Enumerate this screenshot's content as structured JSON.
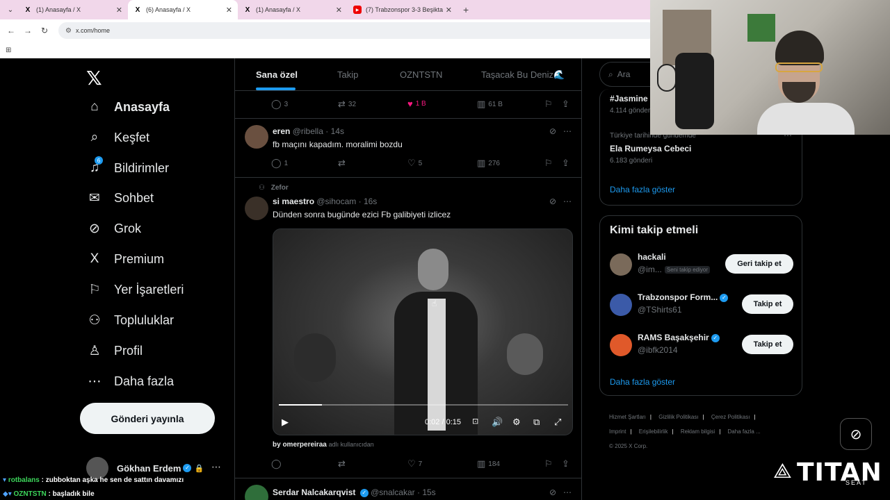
{
  "browser": {
    "tabs": [
      {
        "title": "(1) Anasayfa / X",
        "favicon": "x-icon",
        "active": false
      },
      {
        "title": "(6) Anasayfa / X",
        "favicon": "x-icon",
        "active": true
      },
      {
        "title": "(1) Anasayfa / X",
        "favicon": "x-icon",
        "active": false
      },
      {
        "title": "(7) Trabzonspor 3-3 Beşiktaş | M",
        "favicon": "youtube-icon",
        "active": false
      }
    ],
    "url": "x.com/home"
  },
  "sidebar": {
    "logo": "𝕏",
    "items": [
      {
        "label": "Anasayfa",
        "icon": "home-icon",
        "glyph": "⌂",
        "active": true
      },
      {
        "label": "Keşfet",
        "icon": "search-icon",
        "glyph": "⌕"
      },
      {
        "label": "Bildirimler",
        "icon": "bell-icon",
        "glyph": "♫",
        "badge": "6"
      },
      {
        "label": "Sohbet",
        "icon": "mail-icon",
        "glyph": "✉"
      },
      {
        "label": "Grok",
        "icon": "grok-icon",
        "glyph": "⊘"
      },
      {
        "label": "Premium",
        "icon": "x-premium-icon",
        "glyph": "X"
      },
      {
        "label": "Yer İşaretleri",
        "icon": "bookmark-icon",
        "glyph": "⚐"
      },
      {
        "label": "Topluluklar",
        "icon": "communities-icon",
        "glyph": "⚇"
      },
      {
        "label": "Profil",
        "icon": "profile-icon",
        "glyph": "♙"
      },
      {
        "label": "Daha fazla",
        "icon": "more-icon",
        "glyph": "⋯"
      }
    ],
    "post_button": "Gönderi yayınla",
    "account_name": "Gökhan Erdem"
  },
  "feed": {
    "tabs": [
      "Sana özel",
      "Takip",
      "OZNTSTN",
      "Taşacak Bu Deniz🌊"
    ],
    "prev_actions": {
      "replies": "3",
      "reposts": "32",
      "likes": "1 B",
      "views": "61 B"
    },
    "posts": [
      {
        "name": "eren",
        "handle": "@ribella",
        "time": "14s",
        "text": "fb maçını kapadım. moralimi bozdu",
        "replies": "1",
        "reposts": "",
        "likes": "5",
        "views": "276"
      },
      {
        "reposted_by": "Zefor",
        "name": "si maestro",
        "handle": "@sihocam",
        "time": "16s",
        "text": "Dünden sonra bugünde ezici Fb galibiyeti izlicez",
        "video_time": "0:02 / 0:15",
        "video_progress": 0.15,
        "credit_user": "by omerpereiraa",
        "credit_suffix": "adlı kullanıcıdan",
        "replies": "",
        "reposts": "",
        "likes": "7",
        "views": "184"
      },
      {
        "name": "Serdar Nalcakarqvist",
        "handle": "@snalcakar",
        "time": "15s"
      }
    ]
  },
  "right": {
    "search_placeholder": "Ara",
    "trends": [
      {
        "tag": "#Jasmine",
        "meta": "4.114 gönderi"
      },
      {
        "context": "Türkiye tarihinde gündemde",
        "tag": "Ela Rumeysa Cebeci",
        "meta": "6.183 gönderi"
      }
    ],
    "trends_more": "Daha fazla göster",
    "who_to_follow": {
      "title": "Kimi takip etmeli",
      "accounts": [
        {
          "name": "hackali",
          "handle": "@im...",
          "follows_you": "Seni takip ediyor",
          "button": "Geri takip et",
          "avatar_color": "#7a6a5a"
        },
        {
          "name": "Trabzonspor Form...",
          "handle": "@TShirts61",
          "button": "Takip et",
          "verified": true,
          "avatar_color": "#3b5aa8"
        },
        {
          "name": "RAMS Başakşehir",
          "handle": "@ibfk2014",
          "button": "Takip et",
          "verified": true,
          "avatar_color": "#e0592a"
        }
      ],
      "more": "Daha fazla göster"
    },
    "footer": [
      "Hizmet Şartları",
      "Gizlilik Politikası",
      "Çerez Politikası",
      "Imprint",
      "Erişilebilirlik",
      "Reklam bilgisi",
      "Daha fazla ...",
      "© 2025 X Corp."
    ]
  },
  "overlay": {
    "chat": [
      {
        "user": "rotbalans",
        "message": ": zubboktan aşka he sen de sattın davamızı"
      },
      {
        "user": "OZNTSTN",
        "message": ": başladık bile"
      }
    ],
    "brand_name": "TITAN",
    "brand_sub": "SEAT"
  },
  "colors": {
    "accent": "#1d9bf0",
    "like": "#f91880",
    "background": "#000000"
  }
}
